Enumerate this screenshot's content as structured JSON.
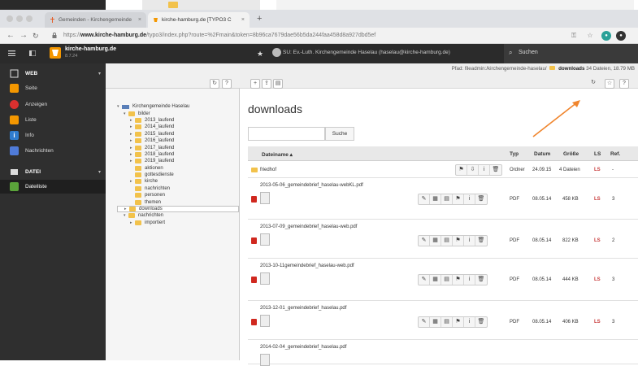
{
  "browser": {
    "tabs": [
      {
        "label": "Gemeinden - Kirchengemeinde",
        "close": "×"
      },
      {
        "label": "kirche-hamburg.de [TYPO3 C",
        "close": "×"
      }
    ],
    "new_tab": "+",
    "url_prefix": "https://",
    "url_host": "www.kirche-hamburg.de",
    "url_rest": "/typo3/index.php?route=%2Fmain&token=8b96ca7679dae56b5da244faa458d8a927dbd5ef"
  },
  "typo3": {
    "site_name": "kirche-hamburg.de",
    "version": "8.7.24",
    "user_info": "SU: Ev.-Luth. Kirchengemeinde Haselau (haselau@kirche-hamburg.de)",
    "search_label": "Suchen"
  },
  "module_menu": {
    "web_group": "WEB",
    "items_web": [
      "Seite",
      "Anzeigen",
      "Liste",
      "Info",
      "Nachrichten"
    ],
    "file_group": "DATEI",
    "items_file": [
      "Dateiliste"
    ]
  },
  "tree": {
    "root": "Kirchengemeinde Haselau",
    "rows": [
      {
        "label": "bilder",
        "level": 1,
        "toggle": "▾"
      },
      {
        "label": "2013_laufend",
        "level": 2,
        "toggle": "▸"
      },
      {
        "label": "2014_laufend",
        "level": 2,
        "toggle": "▸"
      },
      {
        "label": "2015_laufend",
        "level": 2,
        "toggle": "▸"
      },
      {
        "label": "2016_laufend",
        "level": 2,
        "toggle": "▸"
      },
      {
        "label": "2017_laufend",
        "level": 2,
        "toggle": "▸"
      },
      {
        "label": "2018_laufend",
        "level": 2,
        "toggle": "▸"
      },
      {
        "label": "2019_laufend",
        "level": 2,
        "toggle": "▸"
      },
      {
        "label": "aktionen",
        "level": 2,
        "toggle": ""
      },
      {
        "label": "gottesdienste",
        "level": 2,
        "toggle": ""
      },
      {
        "label": "kirche",
        "level": 2,
        "toggle": "▸"
      },
      {
        "label": "nachrichten",
        "level": 2,
        "toggle": ""
      },
      {
        "label": "personen",
        "level": 2,
        "toggle": ""
      },
      {
        "label": "themen",
        "level": 2,
        "toggle": ""
      },
      {
        "label": "downloads",
        "level": 1,
        "toggle": "▸"
      },
      {
        "label": "nachrichten",
        "level": 1,
        "toggle": "▾"
      },
      {
        "label": "importiert",
        "level": 2,
        "toggle": "▸"
      }
    ]
  },
  "path": {
    "prefix": "Pfad: fileadmin:/kirchengemeinde-haselau/",
    "folder": "downloads",
    "summary": "34 Dateien, 18.79 MB"
  },
  "content": {
    "title": "downloads",
    "search_button": "Suche"
  },
  "table": {
    "headers": {
      "name": "Dateiname ▴",
      "type": "Typ",
      "date": "Datum",
      "size": "Größe",
      "ls": "LS",
      "ref": "Ref."
    },
    "folder_row": {
      "name": "friedhof",
      "type": "Ordner",
      "date": "24.09.15",
      "size": "4 Dateien",
      "ls": "LS",
      "ref": "-"
    },
    "files": [
      {
        "name": "2013-05-06_gemeindebrief_haselau-webKL.pdf",
        "type": "PDF",
        "date": "08.05.14",
        "size": "458 KB",
        "ls": "LS",
        "ref": "3"
      },
      {
        "name": "2013-07-09_gemeindebrief_haselau-web.pdf",
        "type": "PDF",
        "date": "08.05.14",
        "size": "822 KB",
        "ls": "LS",
        "ref": "2"
      },
      {
        "name": "2013-10-11gemeindebrief_haselau-web.pdf",
        "type": "PDF",
        "date": "08.05.14",
        "size": "444 KB",
        "ls": "LS",
        "ref": "3"
      },
      {
        "name": "2013-12-01_gemeindebrief_haselau.pdf",
        "type": "PDF",
        "date": "08.05.14",
        "size": "406 KB",
        "ls": "LS",
        "ref": "3"
      },
      {
        "name": "2014-02-04_gemeindebrief_haselau.pdf",
        "type": "",
        "date": "",
        "size": "",
        "ls": "",
        "ref": ""
      }
    ]
  },
  "colors": {
    "accent": "#f49700",
    "ls_red": "#c83c3c",
    "arrow": "#f0852d"
  }
}
